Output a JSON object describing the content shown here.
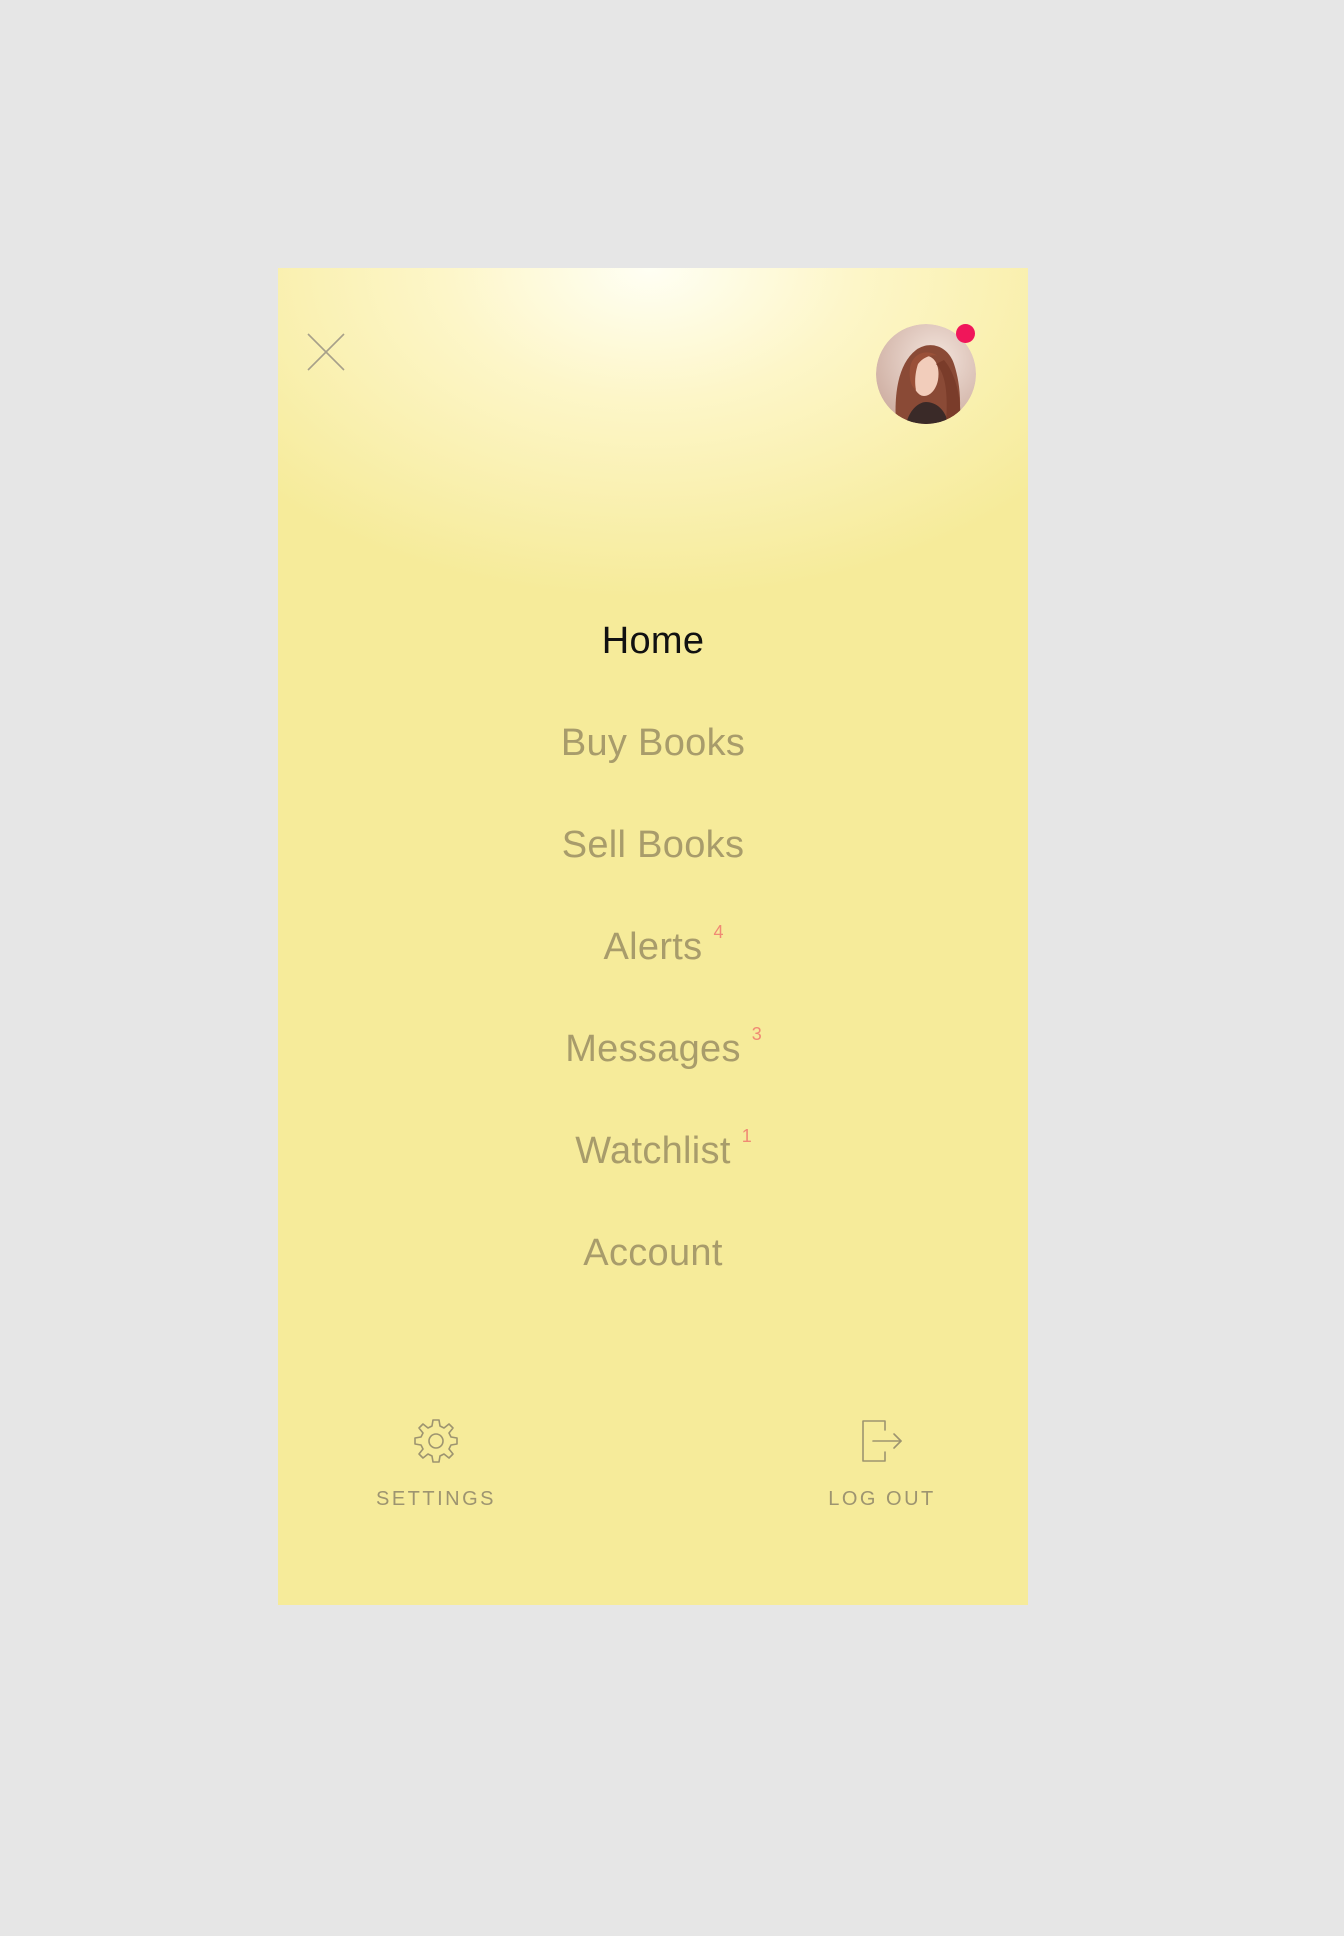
{
  "header": {
    "close_icon": "close-icon",
    "avatar": {
      "description": "profile-photo",
      "status_color": "#f0165a"
    }
  },
  "menu": {
    "items": [
      {
        "label": "Home",
        "badge": null,
        "active": true
      },
      {
        "label": "Buy Books",
        "badge": null,
        "active": false
      },
      {
        "label": "Sell Books",
        "badge": null,
        "active": false
      },
      {
        "label": "Alerts",
        "badge": "4",
        "active": false
      },
      {
        "label": "Messages",
        "badge": "3",
        "active": false
      },
      {
        "label": "Watchlist",
        "badge": "1",
        "active": false
      },
      {
        "label": "Account",
        "badge": null,
        "active": false
      }
    ]
  },
  "footer": {
    "settings": {
      "label": "SETTINGS",
      "icon": "gear-icon"
    },
    "logout": {
      "label": "LOG OUT",
      "icon": "logout-icon"
    }
  },
  "colors": {
    "background": "#e6e6e6",
    "panel": "#f6eb9a",
    "active_text": "#111111",
    "inactive_text": "#a89c6b",
    "badge_text": "#f08a74",
    "status_dot": "#f0165a"
  }
}
